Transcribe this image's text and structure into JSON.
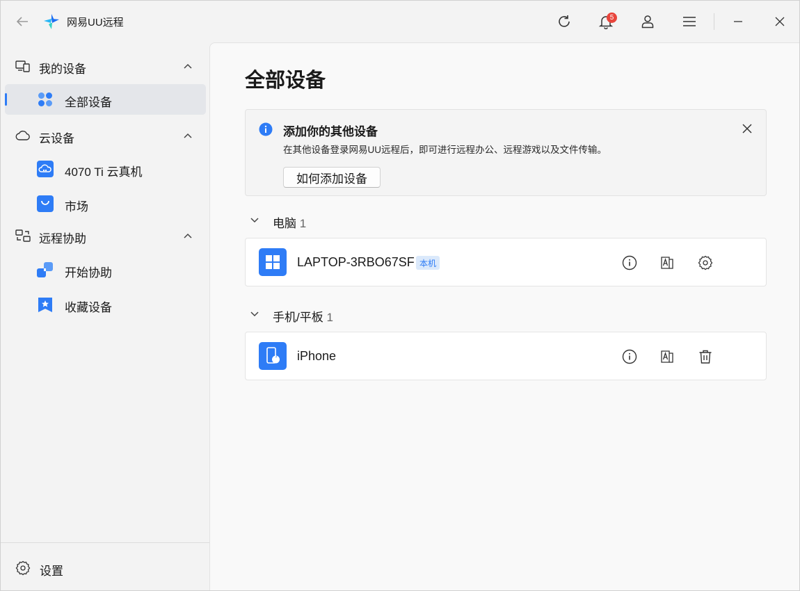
{
  "app": {
    "title": "网易UU远程",
    "notification_count": "5"
  },
  "titlebar": {
    "back_icon": "arrow-left-icon",
    "icons": [
      "refresh-icon",
      "bell-icon",
      "user-icon",
      "menu-icon",
      "minimize-icon",
      "close-icon"
    ]
  },
  "sidebar": {
    "groups": [
      {
        "label": "我的设备",
        "icon": "devices-icon",
        "items": [
          {
            "label": "全部设备",
            "icon": "grid-dots-icon",
            "active": true
          }
        ]
      },
      {
        "label": "云设备",
        "icon": "cloud-icon",
        "items": [
          {
            "label": "4070 Ti 云真机",
            "icon": "cloud-pc-icon"
          },
          {
            "label": "市场",
            "icon": "shopping-bag-icon"
          }
        ]
      },
      {
        "label": "远程协助",
        "icon": "assist-icon",
        "items": [
          {
            "label": "开始协助",
            "icon": "start-assist-icon"
          },
          {
            "label": "收藏设备",
            "icon": "bookmark-star-icon"
          }
        ]
      }
    ],
    "settings_label": "设置"
  },
  "main": {
    "title": "全部设备",
    "banner": {
      "title": "添加你的其他设备",
      "description": "在其他设备登录网易UU远程后，即可进行远程办公、远程游戏以及文件传输。",
      "button_label": "如何添加设备"
    },
    "sections": [
      {
        "label": "电脑",
        "count": "1",
        "devices": [
          {
            "name": "LAPTOP-3RBO67SF",
            "tag": "本机",
            "icon": "windows-icon",
            "actions": [
              "info-icon",
              "translate-icon",
              "gear-icon"
            ]
          }
        ]
      },
      {
        "label": "手机/平板",
        "count": "1",
        "devices": [
          {
            "name": "iPhone",
            "tag": "",
            "icon": "iphone-icon",
            "actions": [
              "info-icon",
              "translate-icon",
              "trash-icon"
            ]
          }
        ]
      }
    ]
  },
  "colors": {
    "accent": "#2e7cf6",
    "badge": "#e8453c",
    "sidebar_bg": "#f3f3f3",
    "main_bg": "#f9f9f9"
  }
}
